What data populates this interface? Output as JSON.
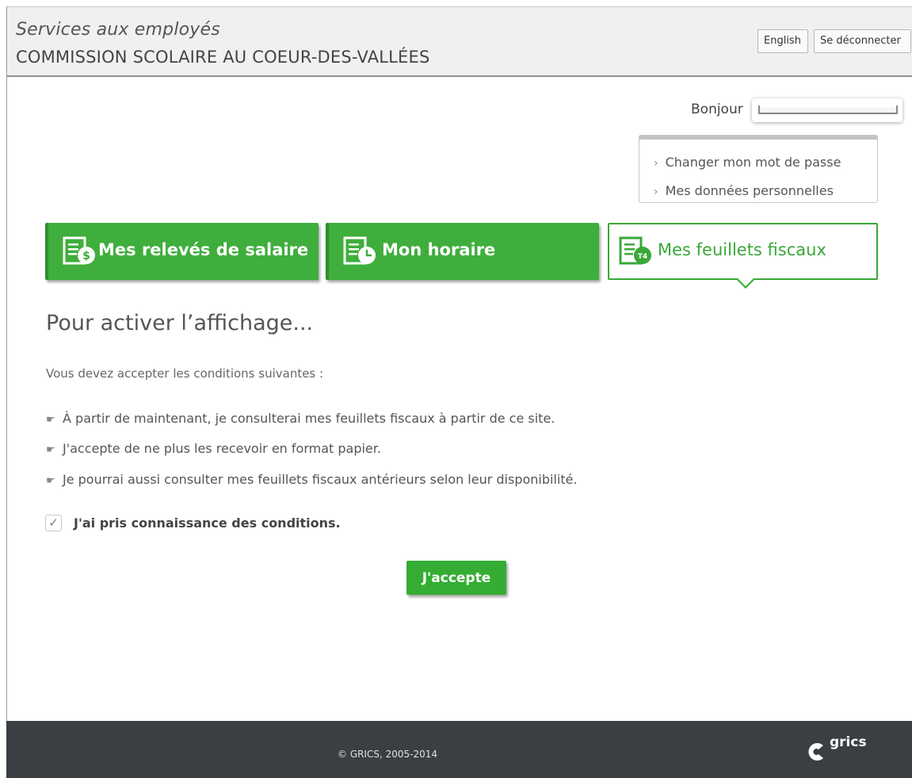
{
  "header": {
    "subtitle": "Services aux employés",
    "organization": "COMMISSION SCOLAIRE AU COEUR-DES-VALLÉES",
    "language_button": "English",
    "logout_button": "Se déconnecter"
  },
  "user": {
    "greeting": "Bonjour"
  },
  "account_menu": {
    "items": [
      {
        "label": "Changer mon mot de passe"
      },
      {
        "label": "Mes données personnelles"
      }
    ]
  },
  "tiles": [
    {
      "label": "Mes relevés de salaire",
      "icon": "pay-statement-icon",
      "active": false
    },
    {
      "label": "Mon horaire",
      "icon": "schedule-icon",
      "active": false
    },
    {
      "label": "Mes feuillets fiscaux",
      "icon": "tax-slip-icon",
      "active": true
    }
  ],
  "main": {
    "title": "Pour activer l’affichage...",
    "intro": "Vous devez accepter les conditions suivantes :",
    "conditions": [
      "À partir de maintenant, je consulterai mes feuillets fiscaux à partir de ce site.",
      "J'accepte de ne plus les recevoir en format papier.",
      "Je pourrai aussi consulter mes feuillets fiscaux antérieurs selon leur disponibilité."
    ],
    "checkbox_label": "J'ai pris connaissance des conditions.",
    "checkbox_checked": true,
    "accept_button": "J'accepte"
  },
  "footer": {
    "copyright": "© GRICS, 2005-2014",
    "logo_text": "grics"
  },
  "colors": {
    "accent_green": "#3fae3c",
    "header_bg": "#f0f0f0",
    "footer_bg": "#3b3f43"
  }
}
